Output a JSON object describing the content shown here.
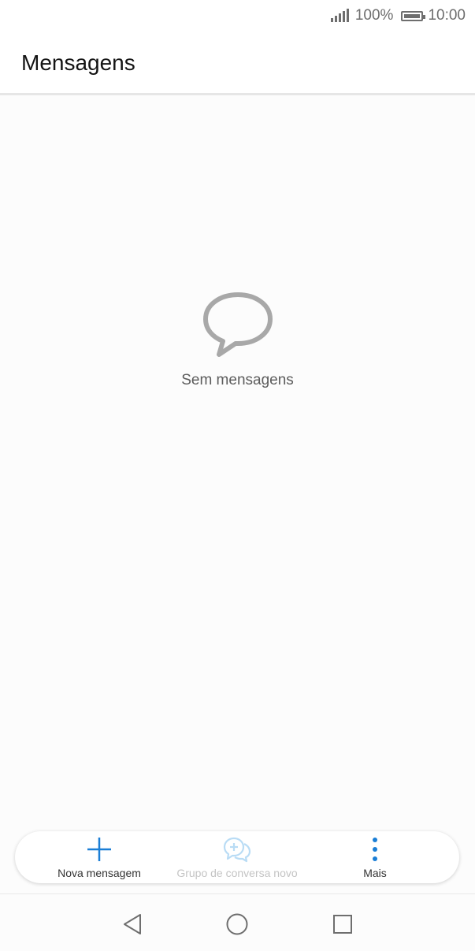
{
  "status_bar": {
    "battery_percent": "100%",
    "time": "10:00"
  },
  "header": {
    "title": "Mensagens"
  },
  "empty_state": {
    "icon": "chat-bubble-icon",
    "text": "Sem mensagens"
  },
  "action_bar": {
    "new_message": {
      "label": "Nova mensagem",
      "icon": "plus-icon"
    },
    "new_group": {
      "label": "Grupo de conversa novo",
      "icon": "group-chat-add-icon",
      "disabled": true
    },
    "more": {
      "label": "Mais",
      "icon": "more-vertical-icon"
    }
  },
  "nav_bar": {
    "back_icon": "back-triangle-icon",
    "home_icon": "home-circle-icon",
    "recent_icon": "recent-square-icon"
  },
  "colors": {
    "accent": "#1a7ed6",
    "accent_disabled": "#b9dcf5",
    "icon_gray": "#a8a8a8",
    "text_primary": "#141414",
    "text_secondary": "#5c5c5c"
  }
}
